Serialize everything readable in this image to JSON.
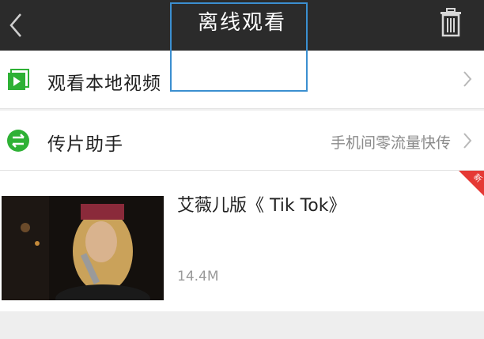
{
  "header": {
    "title": "离线观看",
    "back_icon": "chevron-left-icon",
    "trash_icon": "trash-icon"
  },
  "rows": [
    {
      "label": "观看本地视频",
      "icon": "play-folder-icon",
      "icon_color": "#2eb135"
    },
    {
      "label": "传片助手",
      "sub": "手机间零流量快传",
      "icon": "transfer-icon",
      "icon_color": "#2eb135"
    }
  ],
  "video": {
    "title": "艾薇儿版《 Tik Tok》",
    "size": "14.4M",
    "badge": "新",
    "badge_color": "#e53935"
  },
  "colors": {
    "topbar": "#2b2b2b",
    "highlight": "#3b8fd0"
  }
}
